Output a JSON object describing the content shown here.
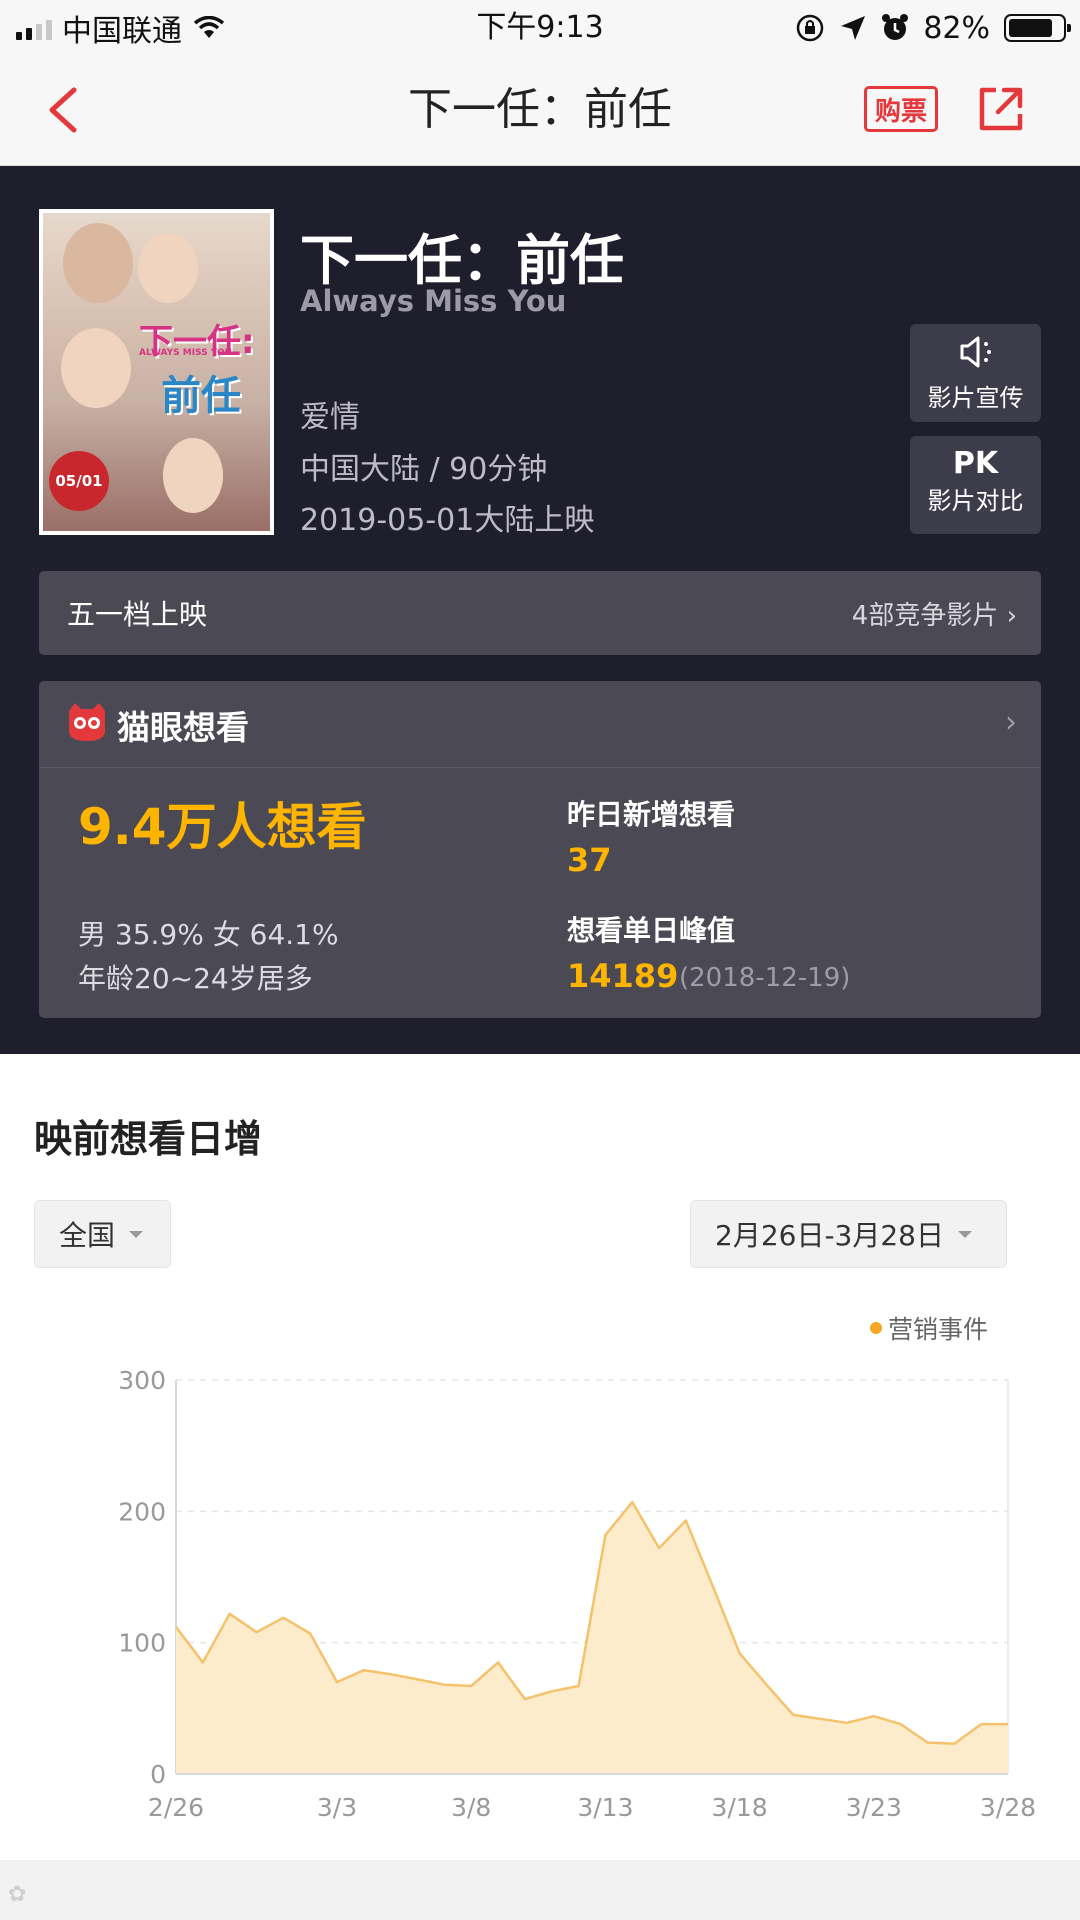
{
  "status_bar": {
    "carrier": "中国联通",
    "time": "下午9:13",
    "battery": "82%",
    "battery_level": 0.82
  },
  "nav": {
    "title": "下一任：前任",
    "buy_label": "购票"
  },
  "movie": {
    "title": "下一任：前任",
    "title_en": "Always Miss You",
    "genre": "爱情",
    "region_duration": "中国大陆 / 90分钟",
    "release": "2019-05-01大陆上映",
    "poster": {
      "title_line1": "下一任:",
      "title_line2": "前任",
      "subtitle": "ALWAYS MISS YOU",
      "stamp": "05/01"
    }
  },
  "side_buttons": {
    "promo_label": "影片宣传",
    "pk_icon": "PK",
    "pk_label": "影片对比"
  },
  "slot": {
    "label": "五一档上映",
    "competitors": "4部竞争影片"
  },
  "want": {
    "brand": "猫眼想看",
    "total": "9.4万人想看",
    "gender": "男 35.9%  女 64.1%",
    "age": "年龄20~24岁居多",
    "yesterday_label": "昨日新增想看",
    "yesterday_value": "37",
    "peak_label": "想看单日峰值",
    "peak_value": "14189",
    "peak_date": "(2018-12-19)"
  },
  "section": {
    "title": "映前想看日增",
    "filter_region": "全国",
    "filter_date": "2月26日-3月28日",
    "legend": "营销事件"
  },
  "colors": {
    "accent_red": "#e4393c",
    "dark_bg": "#1f1e2d",
    "highlight_yellow": "#ffb400",
    "chart_line": "#f5c26b",
    "chart_fill": "#fdeccb"
  },
  "chart_data": {
    "type": "area",
    "x": [
      "2/26",
      "2/27",
      "2/28",
      "2/29",
      "3/1",
      "3/2",
      "3/3",
      "3/4",
      "3/5",
      "3/6",
      "3/7",
      "3/8",
      "3/9",
      "3/10",
      "3/11",
      "3/12",
      "3/13",
      "3/14",
      "3/15",
      "3/16",
      "3/17",
      "3/18",
      "3/19",
      "3/20",
      "3/21",
      "3/22",
      "3/23",
      "3/24",
      "3/25",
      "3/26",
      "3/27",
      "3/28"
    ],
    "values": [
      112,
      85,
      122,
      108,
      119,
      107,
      70,
      79,
      76,
      72,
      68,
      67,
      85,
      57,
      63,
      67,
      182,
      207,
      172,
      193,
      143,
      92,
      68,
      45,
      42,
      39,
      44,
      38,
      24,
      23,
      38,
      38
    ],
    "xticks": [
      "2/26",
      "3/3",
      "3/8",
      "3/13",
      "3/18",
      "3/23",
      "3/28"
    ],
    "yticks": [
      "0",
      "100",
      "200",
      "300"
    ],
    "ylim": [
      0,
      300
    ],
    "grid": true,
    "legend_position": "top-right"
  }
}
